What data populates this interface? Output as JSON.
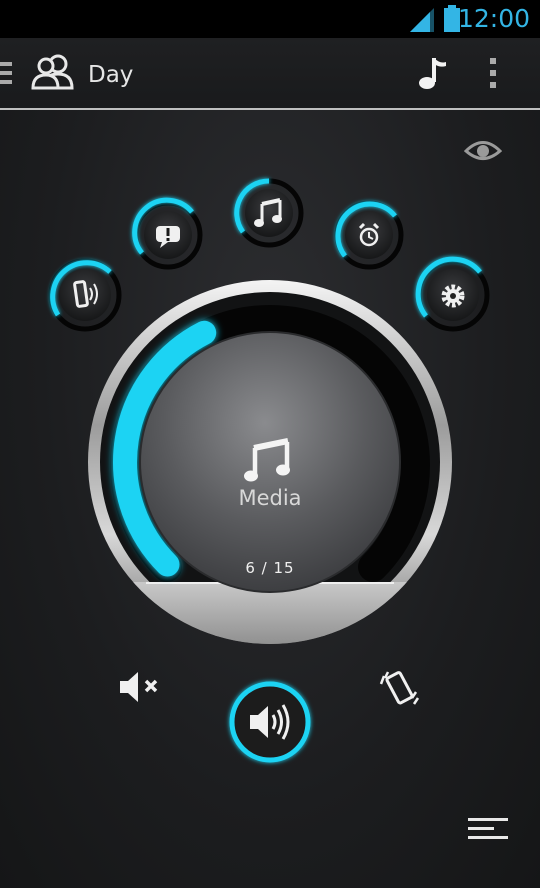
{
  "status_bar": {
    "time": "12:00",
    "signal_icon": "signal-icon",
    "battery_icon": "battery-icon"
  },
  "action_bar": {
    "title": "Day",
    "menu_icon": "drawer-menu-icon",
    "profile_icon": "profile-group-icon",
    "music_icon": "music-note-icon",
    "overflow_icon": "overflow-menu-icon"
  },
  "volume_streams": [
    {
      "name": "ringtone",
      "icon": "ringtone-icon",
      "level": 0.55
    },
    {
      "name": "notification",
      "icon": "notification-icon",
      "level": 0.55
    },
    {
      "name": "media",
      "icon": "music-note-icon",
      "level": 0.4,
      "selected": true
    },
    {
      "name": "alarm",
      "icon": "alarm-clock-icon",
      "level": 0.55
    },
    {
      "name": "system",
      "icon": "gear-icon",
      "level": 0.55
    }
  ],
  "dial": {
    "label": "Media",
    "current": 6,
    "max": 15,
    "count_text": "6 / 15",
    "icon": "music-note-icon"
  },
  "ringer_modes": {
    "mute_icon": "mute-icon",
    "sound_icon": "sound-on-icon",
    "vibrate_icon": "vibrate-icon",
    "selected": "sound"
  },
  "other_icons": {
    "eye": "eye-icon",
    "list": "list-menu-icon"
  },
  "colors": {
    "accent": "#1fd3f3",
    "status_text": "#33b5e5"
  }
}
